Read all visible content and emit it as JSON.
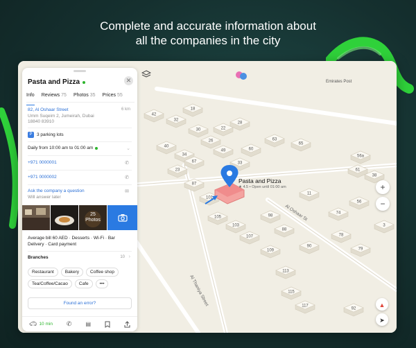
{
  "headline": {
    "line1": "Complete and accurate information about",
    "line2": "all the companies in the city"
  },
  "card": {
    "title": "Pasta and Pizza",
    "tabs": [
      {
        "label": "Info",
        "count": ""
      },
      {
        "label": "Reviews",
        "count": "75"
      },
      {
        "label": "Photos",
        "count": "35"
      },
      {
        "label": "Prices",
        "count": "55"
      }
    ],
    "address": "82, Al Oshaar Street",
    "distance": "6 km",
    "address_line2": "Umm Suqeim 2, Jumeirah, Dubai",
    "postal": "18840 83910",
    "parking": "3 parking lots",
    "hours": "Daily from 10:00 am to 01:00 am",
    "phone1": "+971 0000001",
    "phone2": "+971 0000002",
    "question": "Ask the company a question",
    "question_sub": "Will answer later",
    "photos_more_count": "25",
    "photos_more_label": "Photos",
    "features_line1": "Average bill 60 AED · Desserts · Wi-Fi · Bar",
    "features_line2": "Delivery · Card payment",
    "branches_label": "Branches",
    "branches_count": "10",
    "chips": [
      "Restaurant",
      "Bakery",
      "Coffee shop",
      "Tea/Coffee/Cacao",
      "Cafe",
      "•••"
    ],
    "error_button": "Found an error?",
    "drive_time": "10 min"
  },
  "map": {
    "poi_name": "Pasta and Pizza",
    "poi_rating": "4.5",
    "poi_status": "Open until 01:00 am",
    "emirates_label": "Emirates Post",
    "street_1": "Al Oshaar St",
    "street_2": "Al Thaniya Street",
    "zoom_in": "+",
    "zoom_out": "−",
    "buildings": [
      {
        "n": "42"
      },
      {
        "n": "32"
      },
      {
        "n": "18"
      },
      {
        "n": "30"
      },
      {
        "n": "22"
      },
      {
        "n": "26"
      },
      {
        "n": "28"
      },
      {
        "n": "40"
      },
      {
        "n": "34"
      },
      {
        "n": "49"
      },
      {
        "n": "33"
      },
      {
        "n": "60"
      },
      {
        "n": "23"
      },
      {
        "n": "67"
      },
      {
        "n": "87"
      },
      {
        "n": "101"
      },
      {
        "n": "63"
      },
      {
        "n": "65"
      },
      {
        "n": "103"
      },
      {
        "n": "107"
      },
      {
        "n": "98"
      },
      {
        "n": "56a"
      },
      {
        "n": "61"
      },
      {
        "n": "38"
      },
      {
        "n": "11"
      },
      {
        "n": "105"
      },
      {
        "n": "109"
      },
      {
        "n": "88"
      },
      {
        "n": "90"
      },
      {
        "n": "113"
      },
      {
        "n": "115"
      },
      {
        "n": "117"
      },
      {
        "n": "92"
      },
      {
        "n": "74"
      },
      {
        "n": "78"
      },
      {
        "n": "79"
      },
      {
        "n": "56"
      },
      {
        "n": "3"
      }
    ]
  },
  "colors": {
    "background": "#15302f",
    "accent_blue": "#2a7ae2",
    "open_green": "#2db52d",
    "highlight_building": "#f08c8c",
    "ribbon_green": "#2fd13a"
  }
}
